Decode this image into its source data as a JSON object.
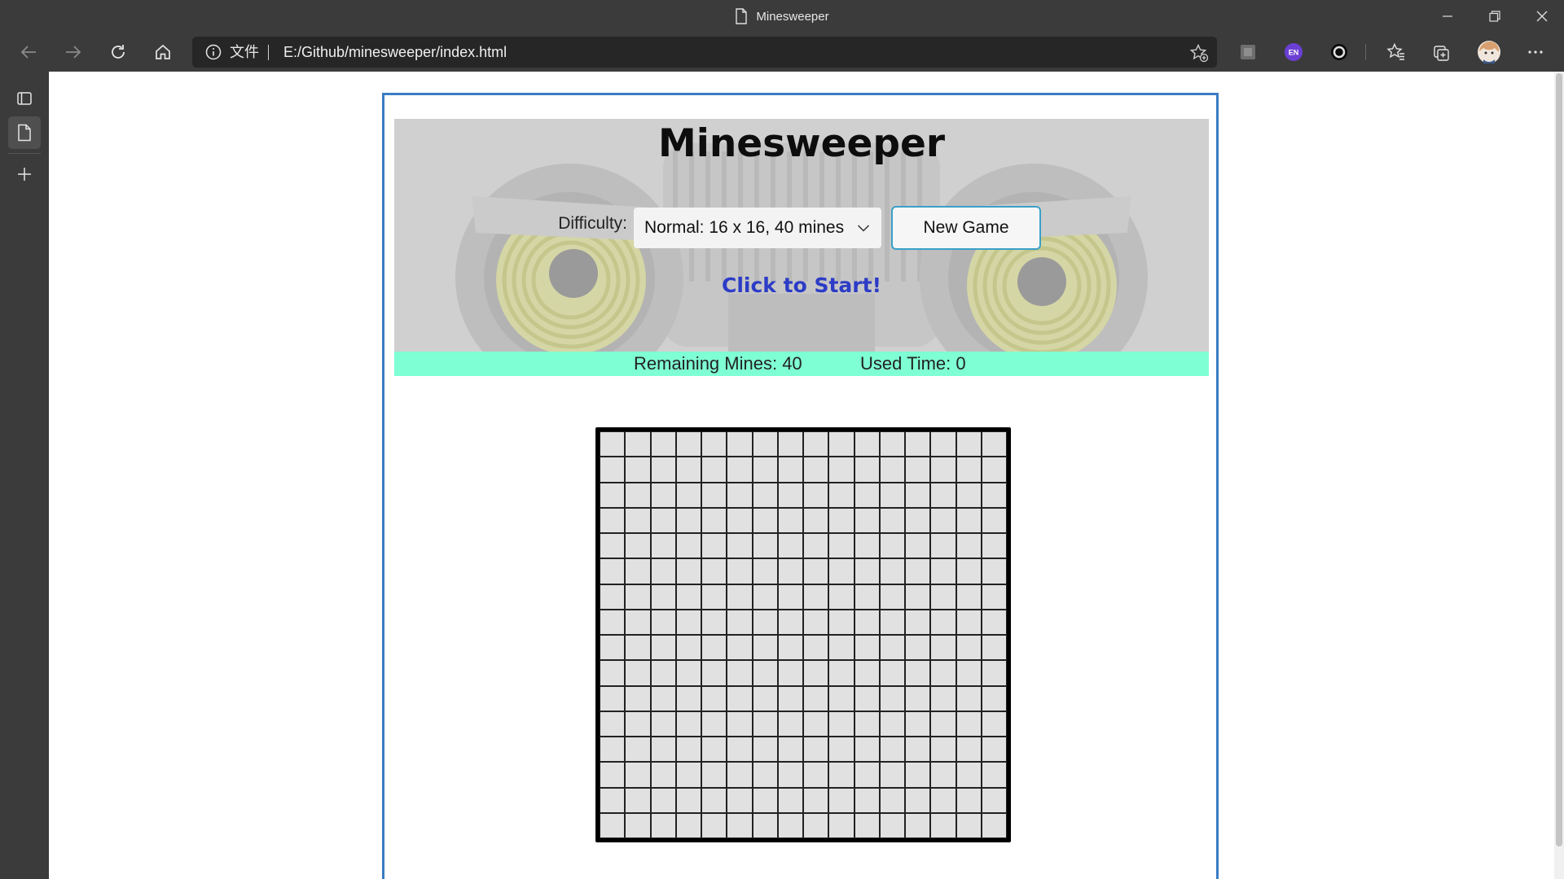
{
  "window": {
    "title": "Minesweeper",
    "controls": [
      "minimize",
      "restore",
      "close"
    ]
  },
  "toolbar": {
    "buttons": [
      "back",
      "forward",
      "refresh",
      "home"
    ],
    "address": {
      "scheme_label": "文件",
      "url": "E:/Github/minesweeper/index.html"
    },
    "extensions": [
      "extension-square-icon",
      "en-extension-icon",
      "circle-extension-icon"
    ],
    "en_badge": "EN",
    "accent_colors": {
      "en_badge": "#6b3fd4"
    }
  },
  "sidebar": {
    "items": [
      "tab-actions",
      "current-tab",
      "new-tab"
    ]
  },
  "game": {
    "title": "Minesweeper",
    "difficulty_label": "Difficulty:",
    "difficulty_selected": "Normal: 16 x 16, 40 mines",
    "new_game_label": "New Game",
    "status_message": "Click to Start!",
    "remaining_mines_text": "Remaining Mines: 40",
    "used_time_text": "Used Time: 0",
    "board": {
      "rows": 16,
      "cols": 16,
      "state": "all-covered"
    },
    "colors": {
      "stats_bar": "#7fffd4",
      "status_text": "#2c3cc6",
      "container_border": "#3a7cc2",
      "cell": "#e1e1e1"
    }
  }
}
